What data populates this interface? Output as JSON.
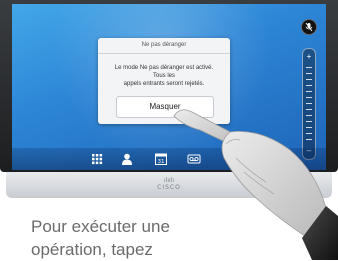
{
  "dialog": {
    "title": "Ne pas déranger",
    "message_line1": "Le mode Ne pas déranger est activé. Tous les",
    "message_line2": "appels entrants seront rejetés.",
    "button_label": "Masquer"
  },
  "device": {
    "brand_text": "CISCO",
    "brand_dots": "ılıılı"
  },
  "tray": {
    "items": [
      {
        "icon": "keypad-icon"
      },
      {
        "icon": "contacts-icon"
      },
      {
        "icon": "calendar-icon",
        "label": "31"
      },
      {
        "icon": "voicemail-icon"
      }
    ]
  },
  "volume": {
    "plus": "+",
    "minus": "–"
  },
  "caption": {
    "line1": "Pour exécuter une",
    "line2": "opération, tapez"
  },
  "colors": {
    "screen_blue": "#2d86d6",
    "dialog_bg": "#f3f4f6",
    "caption_text": "#6b6b6b"
  }
}
